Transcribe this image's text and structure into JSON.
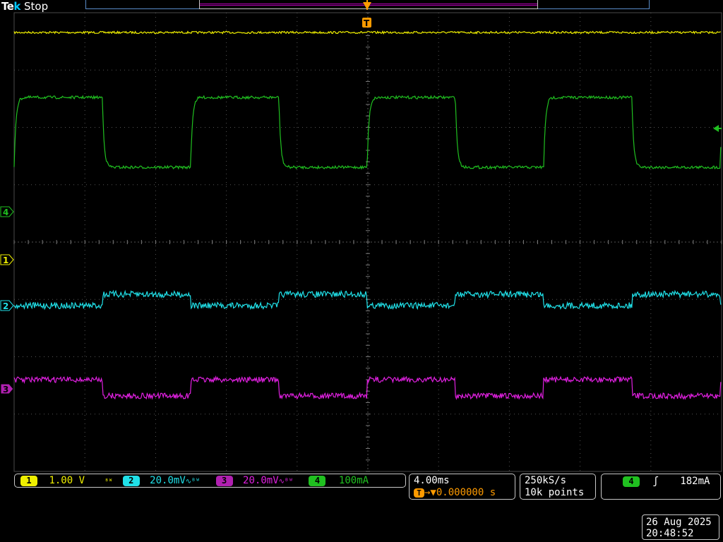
{
  "header": {
    "brand_prefix": "Te",
    "brand_k": "k",
    "acq_state": "Stop"
  },
  "trigger_marker": {
    "label": "T"
  },
  "channels": [
    {
      "id": "1",
      "color": "#f0f000",
      "scale": "1.00 V",
      "suffix": "ᴮᵂ"
    },
    {
      "id": "2",
      "color": "#20e0e8",
      "scale": "20.0mV",
      "suffix": "∿ᴮᵂ"
    },
    {
      "id": "3",
      "color": "#e020e0",
      "scale": "20.0mV",
      "suffix": "∿ᴮᵂ"
    },
    {
      "id": "4",
      "color": "#20c020",
      "scale": "100mA",
      "suffix": ""
    }
  ],
  "timebase": {
    "scale": "4.00ms",
    "trigger_pos_prefix": "T",
    "trigger_pos": "→▼0.000000 s"
  },
  "acquisition": {
    "sample_rate": "250kS/s",
    "record_length": "10k points"
  },
  "trigger": {
    "source": "4",
    "slope": "ʃ",
    "level": "182mA"
  },
  "datetime": {
    "date": "26 Aug 2025",
    "time": "20:48:52"
  }
}
